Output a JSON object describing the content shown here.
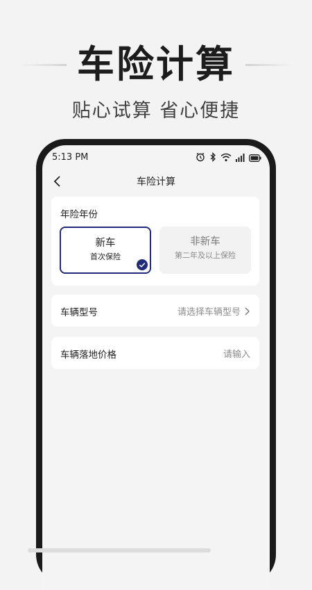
{
  "promo": {
    "title": "车险计算",
    "subtitle": "贴心试算 省心便捷"
  },
  "status_bar": {
    "time": "5:13 PM",
    "icons": [
      "alarm-icon",
      "bluetooth-icon",
      "wifi-icon",
      "signal-icon",
      "battery-icon"
    ]
  },
  "nav": {
    "title": "车险计算",
    "back_icon": "chevron-left-icon"
  },
  "insurance_year": {
    "label": "年险年份",
    "options": [
      {
        "title": "新车",
        "subtitle": "首次保险",
        "selected": true
      },
      {
        "title": "非新车",
        "subtitle": "第二年及以上保险",
        "selected": false
      }
    ]
  },
  "vehicle_model": {
    "label": "车辆型号",
    "placeholder": "请选择车辆型号"
  },
  "landing_price": {
    "label": "车辆落地价格",
    "placeholder": "请输入"
  },
  "colors": {
    "accent": "#1f2a7a",
    "page_bg": "#f3f3f3",
    "card_bg": "#ffffff",
    "muted_text": "#8c8c8c"
  }
}
